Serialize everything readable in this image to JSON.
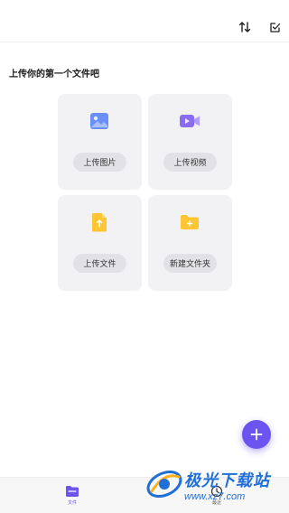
{
  "header": {
    "sort_icon": "sort-arrows-icon",
    "select_icon": "checkbox-edit-icon"
  },
  "main": {
    "heading": "上传你的第一个文件吧",
    "cards": [
      {
        "label": "上传图片",
        "icon": "image-icon",
        "color": "#6a8ff7"
      },
      {
        "label": "上传视频",
        "icon": "video-icon",
        "color": "#8a6cf2"
      },
      {
        "label": "上传文件",
        "icon": "document-icon",
        "color": "#ffc533"
      },
      {
        "label": "新建文件夹",
        "icon": "folder-plus-icon",
        "color": "#ffc533"
      }
    ]
  },
  "fab": {
    "icon": "plus-icon",
    "color": "#6b54f0"
  },
  "bottom_nav": {
    "items": [
      {
        "label": "文件",
        "icon": "folder-icon",
        "active": true
      },
      {
        "label": "最近",
        "icon": "clock-icon",
        "active": false
      }
    ]
  },
  "watermark": {
    "title": "极光下载站",
    "url": "www.xz7.com"
  },
  "colors": {
    "accent": "#6b54f0",
    "card_bg": "#f2f2f5"
  }
}
